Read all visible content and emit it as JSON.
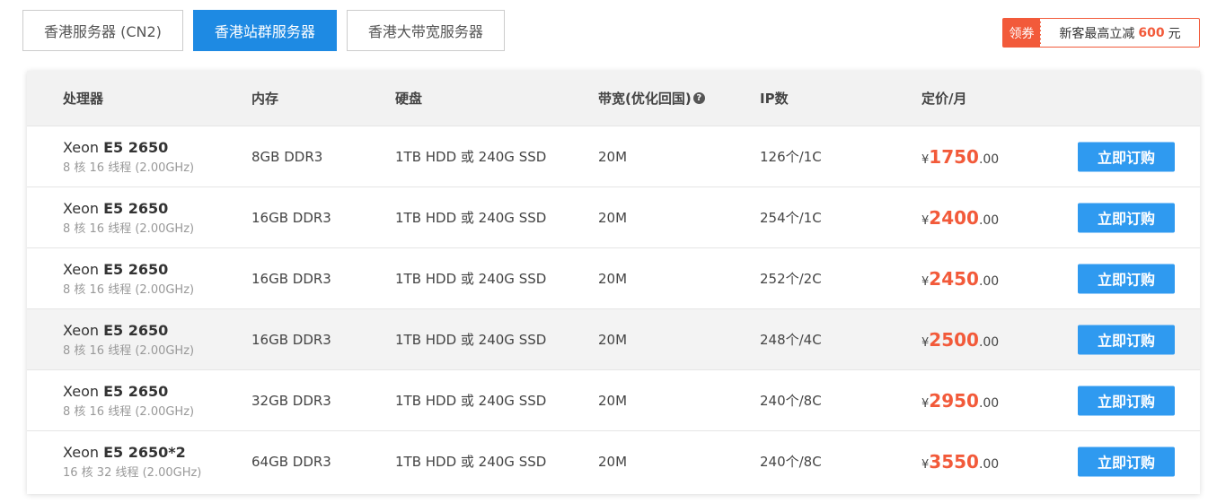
{
  "tabs": [
    {
      "label": "香港服务器 (CN2)",
      "active": false
    },
    {
      "label": "香港站群服务器",
      "active": true
    },
    {
      "label": "香港大带宽服务器",
      "active": false
    }
  ],
  "coupon": {
    "tag": "领券",
    "prefix": "新客最高立减",
    "amount": "600",
    "unit": "元"
  },
  "headers": {
    "cpu": "处理器",
    "memory": "内存",
    "disk": "硬盘",
    "bandwidth": "带宽(优化回国)",
    "ip": "IP数",
    "price": "定价/月",
    "help_glyph": "?"
  },
  "currency": "¥",
  "buy_label": "立即订购",
  "rows": [
    {
      "cpu_brand": "Xeon",
      "cpu_model": "E5 2650",
      "cpu_spec": "8 核 16 线程 (2.00GHz)",
      "memory": "8GB DDR3",
      "disk": "1TB HDD 或 240G SSD",
      "bandwidth": "20M",
      "ip": "126个/1C",
      "price_int": "1750",
      "price_dec": ".00"
    },
    {
      "cpu_brand": "Xeon",
      "cpu_model": "E5 2650",
      "cpu_spec": "8 核 16 线程 (2.00GHz)",
      "memory": "16GB DDR3",
      "disk": "1TB HDD 或 240G SSD",
      "bandwidth": "20M",
      "ip": "254个/1C",
      "price_int": "2400",
      "price_dec": ".00"
    },
    {
      "cpu_brand": "Xeon",
      "cpu_model": "E5 2650",
      "cpu_spec": "8 核 16 线程 (2.00GHz)",
      "memory": "16GB DDR3",
      "disk": "1TB HDD 或 240G SSD",
      "bandwidth": "20M",
      "ip": "252个/2C",
      "price_int": "2450",
      "price_dec": ".00"
    },
    {
      "cpu_brand": "Xeon",
      "cpu_model": "E5 2650",
      "cpu_spec": "8 核 16 线程 (2.00GHz)",
      "memory": "16GB DDR3",
      "disk": "1TB HDD 或 240G SSD",
      "bandwidth": "20M",
      "ip": "248个/4C",
      "price_int": "2500",
      "price_dec": ".00"
    },
    {
      "cpu_brand": "Xeon",
      "cpu_model": "E5 2650",
      "cpu_spec": "8 核 16 线程 (2.00GHz)",
      "memory": "32GB DDR3",
      "disk": "1TB HDD 或 240G SSD",
      "bandwidth": "20M",
      "ip": "240个/8C",
      "price_int": "2950",
      "price_dec": ".00"
    },
    {
      "cpu_brand": "Xeon",
      "cpu_model": "E5 2650*2",
      "cpu_spec": "16 核 32 线程 (2.00GHz)",
      "memory": "64GB DDR3",
      "disk": "1TB HDD 或 240G SSD",
      "bandwidth": "20M",
      "ip": "240个/8C",
      "price_int": "3550",
      "price_dec": ".00"
    }
  ],
  "highlighted_row": 3,
  "colors": {
    "accent": "#1e8ae3",
    "button": "#2f9af0",
    "price": "#f25a3a"
  }
}
